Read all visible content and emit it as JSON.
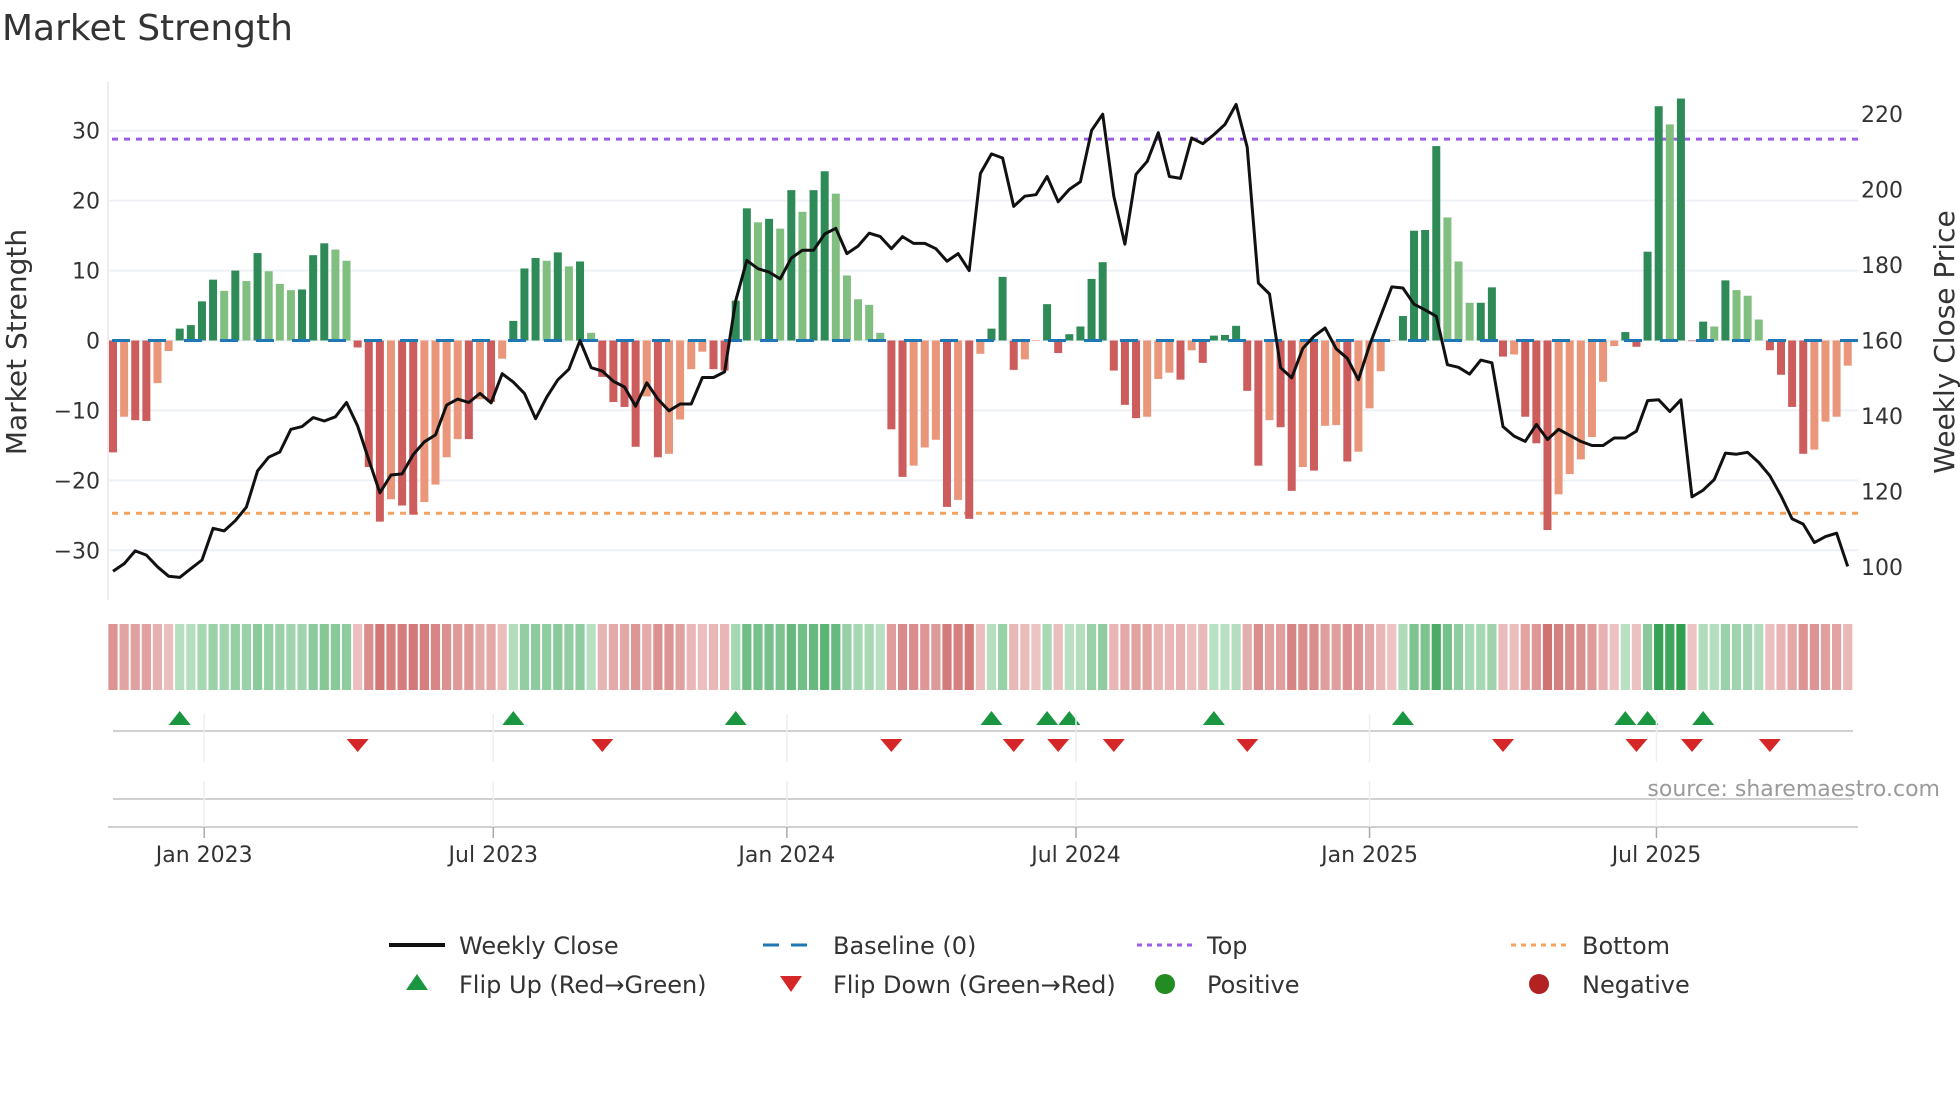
{
  "chart_data": {
    "type": "bar",
    "title": "Market Strength",
    "ylabel": "Market Strength",
    "y2label": "Weekly Close Price",
    "ylim": [
      -36,
      37
    ],
    "y2lim": [
      91,
      232
    ],
    "yticks": [
      "30",
      "20",
      "10",
      "0",
      "−10",
      "−20",
      "−30"
    ],
    "ytick_values": [
      30,
      20,
      10,
      0,
      -10,
      -20,
      -30
    ],
    "y2ticks": [
      "220",
      "200",
      "180",
      "160",
      "140",
      "120",
      "100"
    ],
    "y2tick_values": [
      220,
      200,
      180,
      160,
      140,
      120,
      100
    ],
    "xticks": [
      "Jan 2023",
      "Jul 2023",
      "Jan 2024",
      "Jul 2024",
      "Jan 2025",
      "Jul 2025"
    ],
    "xtick_week_index": [
      8.2,
      34.2,
      60.6,
      86.6,
      113.0,
      138.8
    ],
    "grid": true,
    "top_level": 28.8,
    "bottom_level": -24.7,
    "series": [
      {
        "name": "Market Strength",
        "type": "bar",
        "values": [
          -16.0,
          -10.9,
          -11.4,
          -11.5,
          -6.1,
          -1.5,
          1.7,
          2.2,
          5.6,
          8.7,
          7.1,
          10.0,
          8.5,
          12.5,
          9.9,
          8.1,
          7.2,
          7.3,
          12.2,
          13.9,
          13.0,
          11.4,
          -1.0,
          -18.1,
          -25.9,
          -22.7,
          -23.6,
          -24.9,
          -23.1,
          -20.6,
          -16.7,
          -14.1,
          -14.1,
          -8.4,
          -8.8,
          -2.6,
          2.8,
          10.3,
          11.8,
          11.4,
          12.6,
          10.6,
          11.3,
          1.1,
          -5.2,
          -8.8,
          -9.5,
          -15.2,
          -8.0,
          -16.7,
          -16.2,
          -11.3,
          -4.1,
          -1.6,
          -4.1,
          -4.3,
          5.7,
          18.9,
          16.9,
          17.4,
          16.0,
          21.5,
          18.4,
          21.5,
          24.2,
          21.0,
          9.3,
          5.9,
          5.1,
          1.1,
          -12.7,
          -19.5,
          -17.9,
          -15.3,
          -14.2,
          -23.8,
          -22.8,
          -25.5,
          -1.9,
          1.7,
          9.1,
          -4.2,
          -2.7,
          0,
          5.2,
          -1.8,
          0.9,
          2.0,
          8.8,
          11.2,
          -4.3,
          -9.2,
          -11.1,
          -10.9,
          -5.5,
          -4.6,
          -5.6,
          -1.4,
          -3.2,
          0.7,
          0.8,
          2.1,
          -7.2,
          -17.9,
          -11.4,
          -12.4,
          -21.5,
          -18.1,
          -18.6,
          -12.2,
          -12.1,
          -17.3,
          -15.9,
          -9.7,
          -4.4,
          0,
          3.5,
          15.7,
          15.8,
          27.8,
          17.6,
          11.3,
          5.4,
          5.4,
          7.6,
          -2.3,
          -2.0,
          -10.9,
          -14.7,
          -27.1,
          -22.0,
          -19.1,
          -17.0,
          -13.8,
          -5.9,
          -0.8,
          1.2,
          -0.9,
          12.7,
          33.5,
          30.9,
          34.6,
          -0.1,
          2.7,
          2.0,
          8.6,
          7.2,
          6.4,
          3.0,
          -1.4,
          -4.9,
          -9.5,
          -16.2,
          -15.6,
          -11.6,
          -10.9,
          -3.6
        ]
      },
      {
        "name": "Weekly Close",
        "type": "line",
        "values": [
          98.9,
          100.9,
          104.3,
          103.2,
          100.1,
          97.6,
          97.3,
          99.6,
          101.9,
          110.3,
          109.6,
          112.3,
          115.9,
          125.5,
          129.1,
          130.5,
          136.5,
          137.2,
          139.6,
          138.7,
          139.8,
          143.6,
          137.4,
          128.4,
          119.7,
          124.4,
          124.7,
          129.8,
          133.2,
          135.0,
          142.9,
          144.5,
          143.6,
          146.0,
          143.5,
          151.2,
          149.0,
          146.0,
          139.3,
          145.0,
          149.6,
          152.4,
          160.0,
          152.8,
          151.9,
          149.2,
          147.7,
          142.6,
          148.8,
          144.5,
          141.4,
          143.2,
          143.2,
          150.2,
          150.2,
          151.7,
          170.5,
          181.2,
          179.0,
          178.1,
          176.3,
          181.8,
          183.9,
          183.9,
          188.2,
          189.7,
          183.0,
          185.0,
          188.4,
          187.5,
          184.3,
          187.5,
          185.7,
          185.7,
          184.3,
          181.0,
          183.0,
          178.5,
          204.2,
          209.4,
          208.3,
          195.5,
          198.2,
          198.6,
          203.4,
          196.7,
          200.0,
          202.0,
          215.6,
          219.9,
          198.2,
          185.5,
          204.0,
          207.4,
          215.0,
          203.4,
          202.9,
          213.6,
          212.1,
          214.5,
          217.2,
          222.5,
          211.2,
          175.2,
          172.3,
          152.8,
          150.1,
          157.9,
          161.1,
          163.3,
          157.8,
          155.3,
          149.6,
          158.8,
          166.5,
          174.2,
          173.9,
          169.6,
          168.1,
          166.4,
          153.6,
          152.9,
          151.1,
          154.8,
          154.1,
          137.2,
          134.7,
          133.3,
          137.8,
          133.8,
          136.5,
          134.9,
          133.3,
          132.2,
          132.2,
          134.2,
          134.2,
          136.0,
          144.1,
          144.3,
          141.2,
          144.3,
          118.6,
          120.4,
          123.2,
          130.2,
          129.9,
          130.4,
          127.7,
          124.2,
          118.9,
          112.8,
          111.4,
          106.5,
          108.1,
          109.0,
          100.2
        ]
      }
    ],
    "legend": {
      "placement": "bottom",
      "items": [
        {
          "label": "Weekly Close",
          "symbol": "line"
        },
        {
          "label": "Baseline (0)",
          "symbol": "dash"
        },
        {
          "label": "Top",
          "symbol": "dot-purple"
        },
        {
          "label": "Bottom",
          "symbol": "dot-orange"
        },
        {
          "label": "Flip Up (Red→Green)",
          "symbol": "triangle-up"
        },
        {
          "label": "Flip Down (Green→Red)",
          "symbol": "triangle-down"
        },
        {
          "label": "Positive",
          "symbol": "circle-green"
        },
        {
          "label": "Negative",
          "symbol": "circle-red"
        }
      ]
    },
    "source": "source: sharemaestro.com"
  },
  "colors": {
    "pos_rising": "#2e8b57",
    "pos_falling": "#80bf80",
    "neg_falling": "#cd5c5c",
    "neg_rising": "#e9967a",
    "line": "#111111",
    "baseline": "#1f77b4",
    "top": "#9b5de5",
    "bottom": "#f4a460",
    "flip_up": "#1a9641",
    "flip_down": "#d62728",
    "positive": "#228b22",
    "negative": "#b22222",
    "grid": "#edf0f5"
  }
}
